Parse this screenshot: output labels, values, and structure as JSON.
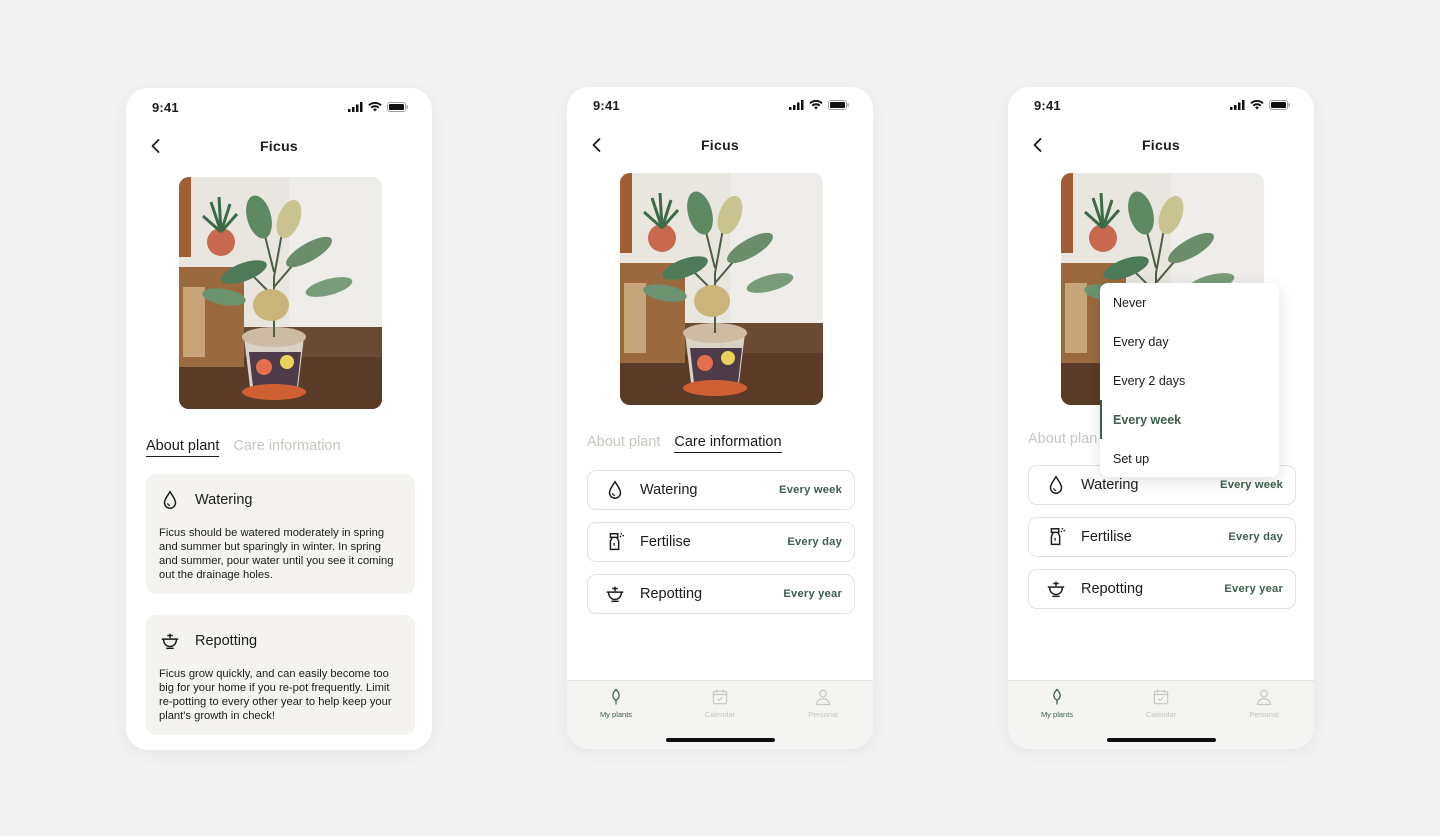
{
  "status": {
    "time": "9:41"
  },
  "screens": [
    {
      "title": "Ficus",
      "tabs": [
        {
          "label": "About plant"
        },
        {
          "label": "Care information"
        }
      ],
      "cards": [
        {
          "title": "Watering",
          "icon": "water-drop-icon",
          "body": "Ficus should be watered moderately in spring and summer but sparingly in winter. In spring and summer, pour water until you see it coming out the drainage holes."
        },
        {
          "title": "Repotting",
          "icon": "pot-icon",
          "body": "Ficus grow quickly, and can easily become too big for your home if you re-pot frequently. Limit re-potting to every other year to help keep your plant's growth in check!"
        }
      ]
    },
    {
      "title": "Ficus",
      "tabs": [
        {
          "label": "About plant"
        },
        {
          "label": "Care information"
        }
      ],
      "care": [
        {
          "label": "Watering",
          "frequency": "Every week",
          "icon": "water-drop-icon"
        },
        {
          "label": "Fertilise",
          "frequency": "Every day",
          "icon": "spray-bottle-icon"
        },
        {
          "label": "Repotting",
          "frequency": "Every year",
          "icon": "pot-icon"
        }
      ],
      "nav": [
        {
          "label": "My plants",
          "icon": "leaf-icon"
        },
        {
          "label": "Calendar",
          "icon": "calendar-icon"
        },
        {
          "label": "Personal",
          "icon": "person-icon"
        }
      ]
    },
    {
      "title": "Ficus",
      "tab_partial": "About plan",
      "care": [
        {
          "label": "Watering",
          "frequency": "Every week",
          "icon": "water-drop-icon"
        },
        {
          "label": "Fertilise",
          "frequency": "Every day",
          "icon": "spray-bottle-icon"
        },
        {
          "label": "Repotting",
          "frequency": "Every year",
          "icon": "pot-icon"
        }
      ],
      "dropdown": {
        "options": [
          "Never",
          "Every day",
          "Every 2 days",
          "Every week",
          "Set up"
        ],
        "selected": "Every week"
      },
      "nav": [
        {
          "label": "My plants",
          "icon": "leaf-icon"
        },
        {
          "label": "Calendar",
          "icon": "calendar-icon"
        },
        {
          "label": "Personal",
          "icon": "person-icon"
        }
      ]
    }
  ],
  "colors": {
    "accent": "#3e5e4d",
    "card_bg": "#f4f3f0",
    "inactive_tab": "#c9c6c0",
    "page_bg": "#f3f3f3"
  }
}
